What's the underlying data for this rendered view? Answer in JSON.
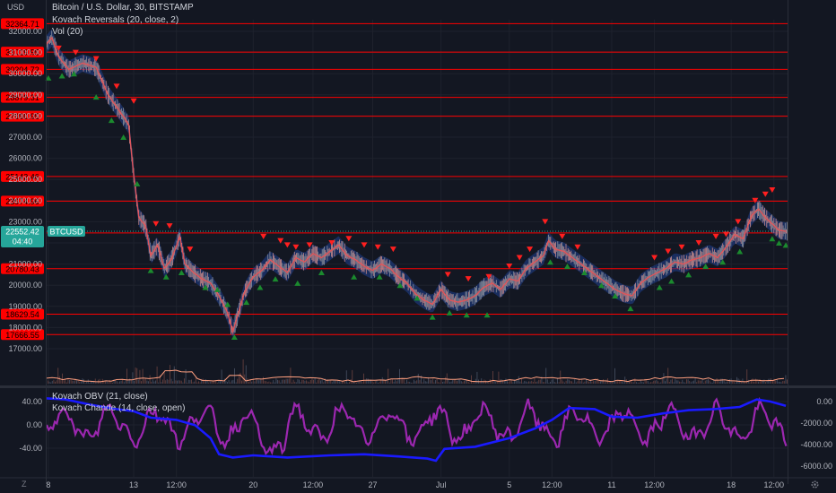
{
  "header": {
    "unit": "USD",
    "symbol_line": "Bitcoin / U.S. Dollar, 30, BITSTAMP",
    "indicator1": "Kovach Reversals (20, close, 2)",
    "indicator2": "Vol (20)",
    "osc1": "Kovach OBV (21, close)",
    "osc2": "Kovach Chande (14, close, open)"
  },
  "footer": {
    "zoom_label": "Z",
    "settings_icon": "gear-icon"
  },
  "colors": {
    "background": "#131722",
    "level_line": "#ff0000",
    "level_label": "#ff0000",
    "price_label": "#26a69a",
    "up_arrow": "#1b8a2e",
    "down_arrow": "#ff1f1f",
    "obv_line": "#1a1aff",
    "chande_line": "#9c27b0",
    "band": "#1f3f8f"
  },
  "chart_data": [
    {
      "type": "line",
      "y_ticks": [
        "32000.00",
        "31000.00",
        "30000.00",
        "29000.00",
        "28000.00",
        "27000.00",
        "26000.00",
        "25000.00",
        "24000.00",
        "23000.00",
        "22000.00",
        "21000.00",
        "20000.00",
        "19000.00",
        "18000.00",
        "17000.00"
      ],
      "ylim": [
        16500,
        32700
      ],
      "x_ticks": [
        "8",
        "13",
        "12:00",
        "20",
        "12:00",
        "27",
        "Jul",
        "5",
        "12:00",
        "11",
        "12:00",
        "18",
        "12:00"
      ],
      "x_tick_days": [
        8,
        13,
        15.5,
        20,
        23.5,
        27,
        31,
        35,
        37.5,
        41,
        43.5,
        48,
        50.5
      ],
      "x_range": [
        7.9,
        51.3
      ],
      "price_levels": [
        32364.71,
        31019.95,
        30204.72,
        28879.31,
        27990.95,
        25142.46,
        23974.96,
        22469.27,
        20780.43,
        18629.54,
        17666.55
      ],
      "current_price": {
        "label": "22552.42",
        "countdown": "04:40",
        "tag": "BTCUSD",
        "value": 22552.42
      },
      "price_path": [
        {
          "x": 7.9,
          "y": 31400
        },
        {
          "x": 8.2,
          "y": 31700
        },
        {
          "x": 8.6,
          "y": 30800
        },
        {
          "x": 9.2,
          "y": 30200
        },
        {
          "x": 10.0,
          "y": 30500
        },
        {
          "x": 10.8,
          "y": 30300
        },
        {
          "x": 11.5,
          "y": 29000
        },
        {
          "x": 12.2,
          "y": 28200
        },
        {
          "x": 12.7,
          "y": 27600
        },
        {
          "x": 13.0,
          "y": 25200
        },
        {
          "x": 13.3,
          "y": 23200
        },
        {
          "x": 13.7,
          "y": 22800
        },
        {
          "x": 14.0,
          "y": 21400
        },
        {
          "x": 14.4,
          "y": 21900
        },
        {
          "x": 14.8,
          "y": 20800
        },
        {
          "x": 15.2,
          "y": 21200
        },
        {
          "x": 15.7,
          "y": 22300
        },
        {
          "x": 16.0,
          "y": 21000
        },
        {
          "x": 16.5,
          "y": 20600
        },
        {
          "x": 17.0,
          "y": 20300
        },
        {
          "x": 17.5,
          "y": 20100
        },
        {
          "x": 18.0,
          "y": 19500
        },
        {
          "x": 18.5,
          "y": 18700
        },
        {
          "x": 18.8,
          "y": 17800
        },
        {
          "x": 19.1,
          "y": 18600
        },
        {
          "x": 19.5,
          "y": 19700
        },
        {
          "x": 20.0,
          "y": 20400
        },
        {
          "x": 20.5,
          "y": 20700
        },
        {
          "x": 21.0,
          "y": 21200
        },
        {
          "x": 21.5,
          "y": 20900
        },
        {
          "x": 22.0,
          "y": 20600
        },
        {
          "x": 22.5,
          "y": 21300
        },
        {
          "x": 23.0,
          "y": 21100
        },
        {
          "x": 23.5,
          "y": 21500
        },
        {
          "x": 24.0,
          "y": 21300
        },
        {
          "x": 24.5,
          "y": 21600
        },
        {
          "x": 25.0,
          "y": 21900
        },
        {
          "x": 25.5,
          "y": 21400
        },
        {
          "x": 26.0,
          "y": 21200
        },
        {
          "x": 26.5,
          "y": 20900
        },
        {
          "x": 27.0,
          "y": 20700
        },
        {
          "x": 27.5,
          "y": 21000
        },
        {
          "x": 28.0,
          "y": 20800
        },
        {
          "x": 28.5,
          "y": 20400
        },
        {
          "x": 29.0,
          "y": 20100
        },
        {
          "x": 29.5,
          "y": 19600
        },
        {
          "x": 30.0,
          "y": 19300
        },
        {
          "x": 30.5,
          "y": 19100
        },
        {
          "x": 31.0,
          "y": 19800
        },
        {
          "x": 31.5,
          "y": 19300
        },
        {
          "x": 32.0,
          "y": 19200
        },
        {
          "x": 32.5,
          "y": 19300
        },
        {
          "x": 33.0,
          "y": 19500
        },
        {
          "x": 33.5,
          "y": 19900
        },
        {
          "x": 34.0,
          "y": 20100
        },
        {
          "x": 34.5,
          "y": 19800
        },
        {
          "x": 35.0,
          "y": 20300
        },
        {
          "x": 35.5,
          "y": 20200
        },
        {
          "x": 36.0,
          "y": 20800
        },
        {
          "x": 36.5,
          "y": 21100
        },
        {
          "x": 37.0,
          "y": 21400
        },
        {
          "x": 37.3,
          "y": 22100
        },
        {
          "x": 37.7,
          "y": 21700
        },
        {
          "x": 38.2,
          "y": 21600
        },
        {
          "x": 38.7,
          "y": 21300
        },
        {
          "x": 39.2,
          "y": 21000
        },
        {
          "x": 39.7,
          "y": 20700
        },
        {
          "x": 40.2,
          "y": 20400
        },
        {
          "x": 40.7,
          "y": 20100
        },
        {
          "x": 41.2,
          "y": 19800
        },
        {
          "x": 41.7,
          "y": 19600
        },
        {
          "x": 42.2,
          "y": 19500
        },
        {
          "x": 42.7,
          "y": 20100
        },
        {
          "x": 43.2,
          "y": 20400
        },
        {
          "x": 43.7,
          "y": 20600
        },
        {
          "x": 44.2,
          "y": 20800
        },
        {
          "x": 44.7,
          "y": 21100
        },
        {
          "x": 45.2,
          "y": 21000
        },
        {
          "x": 45.7,
          "y": 21200
        },
        {
          "x": 46.2,
          "y": 21300
        },
        {
          "x": 46.7,
          "y": 21500
        },
        {
          "x": 47.2,
          "y": 21300
        },
        {
          "x": 47.7,
          "y": 21800
        },
        {
          "x": 48.2,
          "y": 22400
        },
        {
          "x": 48.7,
          "y": 22200
        },
        {
          "x": 49.2,
          "y": 23300
        },
        {
          "x": 49.6,
          "y": 23600
        },
        {
          "x": 50.0,
          "y": 23200
        },
        {
          "x": 50.4,
          "y": 22900
        },
        {
          "x": 50.8,
          "y": 22600
        },
        {
          "x": 51.2,
          "y": 22550
        }
      ],
      "sell_signals": [
        {
          "x": 8.6,
          "y": 31200
        },
        {
          "x": 9.6,
          "y": 31000
        },
        {
          "x": 10.8,
          "y": 30700
        },
        {
          "x": 12.0,
          "y": 29400
        },
        {
          "x": 13.0,
          "y": 28700
        },
        {
          "x": 14.3,
          "y": 22900
        },
        {
          "x": 15.1,
          "y": 22800
        },
        {
          "x": 16.3,
          "y": 21700
        },
        {
          "x": 20.6,
          "y": 22300
        },
        {
          "x": 21.6,
          "y": 22100
        },
        {
          "x": 22.0,
          "y": 21900
        },
        {
          "x": 22.5,
          "y": 21800
        },
        {
          "x": 23.3,
          "y": 21900
        },
        {
          "x": 24.6,
          "y": 22000
        },
        {
          "x": 25.6,
          "y": 22200
        },
        {
          "x": 26.5,
          "y": 21900
        },
        {
          "x": 27.3,
          "y": 21800
        },
        {
          "x": 28.2,
          "y": 21700
        },
        {
          "x": 31.4,
          "y": 20500
        },
        {
          "x": 32.6,
          "y": 20300
        },
        {
          "x": 33.8,
          "y": 20400
        },
        {
          "x": 35.0,
          "y": 20900
        },
        {
          "x": 35.6,
          "y": 21300
        },
        {
          "x": 36.2,
          "y": 21700
        },
        {
          "x": 37.1,
          "y": 23000
        },
        {
          "x": 38.1,
          "y": 22300
        },
        {
          "x": 39.0,
          "y": 21800
        },
        {
          "x": 43.5,
          "y": 21300
        },
        {
          "x": 44.3,
          "y": 21600
        },
        {
          "x": 45.1,
          "y": 21800
        },
        {
          "x": 46.1,
          "y": 22000
        },
        {
          "x": 47.1,
          "y": 22300
        },
        {
          "x": 47.7,
          "y": 22400
        },
        {
          "x": 48.4,
          "y": 23000
        },
        {
          "x": 49.4,
          "y": 24000
        },
        {
          "x": 50.0,
          "y": 24300
        },
        {
          "x": 50.4,
          "y": 24500
        }
      ],
      "buy_signals": [
        {
          "x": 8.0,
          "y": 29800
        },
        {
          "x": 8.8,
          "y": 29900
        },
        {
          "x": 9.5,
          "y": 30000
        },
        {
          "x": 10.8,
          "y": 28900
        },
        {
          "x": 11.7,
          "y": 27800
        },
        {
          "x": 12.4,
          "y": 27000
        },
        {
          "x": 13.2,
          "y": 24800
        },
        {
          "x": 14.0,
          "y": 20700
        },
        {
          "x": 14.9,
          "y": 20400
        },
        {
          "x": 15.8,
          "y": 20600
        },
        {
          "x": 17.2,
          "y": 19900
        },
        {
          "x": 17.9,
          "y": 19800
        },
        {
          "x": 18.5,
          "y": 19100
        },
        {
          "x": 18.9,
          "y": 17550
        },
        {
          "x": 19.6,
          "y": 19200
        },
        {
          "x": 20.4,
          "y": 19900
        },
        {
          "x": 21.3,
          "y": 20300
        },
        {
          "x": 22.6,
          "y": 20100
        },
        {
          "x": 24.0,
          "y": 20600
        },
        {
          "x": 25.9,
          "y": 20400
        },
        {
          "x": 27.4,
          "y": 20400
        },
        {
          "x": 28.6,
          "y": 20000
        },
        {
          "x": 29.6,
          "y": 19400
        },
        {
          "x": 30.5,
          "y": 18500
        },
        {
          "x": 31.5,
          "y": 18700
        },
        {
          "x": 32.5,
          "y": 18600
        },
        {
          "x": 33.7,
          "y": 18600
        },
        {
          "x": 37.4,
          "y": 21100
        },
        {
          "x": 38.4,
          "y": 20900
        },
        {
          "x": 39.4,
          "y": 20600
        },
        {
          "x": 40.4,
          "y": 20000
        },
        {
          "x": 41.2,
          "y": 19500
        },
        {
          "x": 42.1,
          "y": 18900
        },
        {
          "x": 43.8,
          "y": 19900
        },
        {
          "x": 44.5,
          "y": 20200
        },
        {
          "x": 45.5,
          "y": 20500
        },
        {
          "x": 46.5,
          "y": 20900
        },
        {
          "x": 47.5,
          "y": 21100
        },
        {
          "x": 48.5,
          "y": 21600
        },
        {
          "x": 50.4,
          "y": 22200
        },
        {
          "x": 50.8,
          "y": 22000
        },
        {
          "x": 51.2,
          "y": 21900
        }
      ]
    },
    {
      "type": "line",
      "name": "Kovach OBV (21, close)",
      "y_ticks": [
        "0.00",
        "-2000.00",
        "-4000.00",
        "-6000.00"
      ],
      "ylim": [
        -6900,
        800
      ],
      "points": [
        {
          "x": 7.9,
          "y": 300
        },
        {
          "x": 9.0,
          "y": 200
        },
        {
          "x": 10.5,
          "y": -300
        },
        {
          "x": 12.0,
          "y": -700
        },
        {
          "x": 13.0,
          "y": -900
        },
        {
          "x": 14.0,
          "y": -1500
        },
        {
          "x": 15.5,
          "y": -1700
        },
        {
          "x": 16.6,
          "y": -2200
        },
        {
          "x": 17.5,
          "y": -3400
        },
        {
          "x": 18.0,
          "y": -4900
        },
        {
          "x": 18.8,
          "y": -5200
        },
        {
          "x": 20.0,
          "y": -5000
        },
        {
          "x": 22.0,
          "y": -5200
        },
        {
          "x": 24.5,
          "y": -5000
        },
        {
          "x": 26.5,
          "y": -4900
        },
        {
          "x": 28.5,
          "y": -5100
        },
        {
          "x": 30.2,
          "y": -5300
        },
        {
          "x": 30.7,
          "y": -5500
        },
        {
          "x": 31.2,
          "y": -4400
        },
        {
          "x": 33.0,
          "y": -4200
        },
        {
          "x": 35.0,
          "y": -3400
        },
        {
          "x": 36.5,
          "y": -2500
        },
        {
          "x": 37.5,
          "y": -1700
        },
        {
          "x": 38.5,
          "y": -600
        },
        {
          "x": 40.0,
          "y": -700
        },
        {
          "x": 41.0,
          "y": -1400
        },
        {
          "x": 42.5,
          "y": -1500
        },
        {
          "x": 44.0,
          "y": -1100
        },
        {
          "x": 45.5,
          "y": -800
        },
        {
          "x": 47.0,
          "y": -700
        },
        {
          "x": 48.5,
          "y": -500
        },
        {
          "x": 49.5,
          "y": 200
        },
        {
          "x": 50.3,
          "y": 0
        },
        {
          "x": 51.2,
          "y": -400
        }
      ]
    },
    {
      "type": "line",
      "name": "Kovach Chande (14, close, open)",
      "y_ticks": [
        "40.00",
        "0.00",
        "-40.00"
      ],
      "ylim": [
        -62,
        58
      ]
    }
  ]
}
